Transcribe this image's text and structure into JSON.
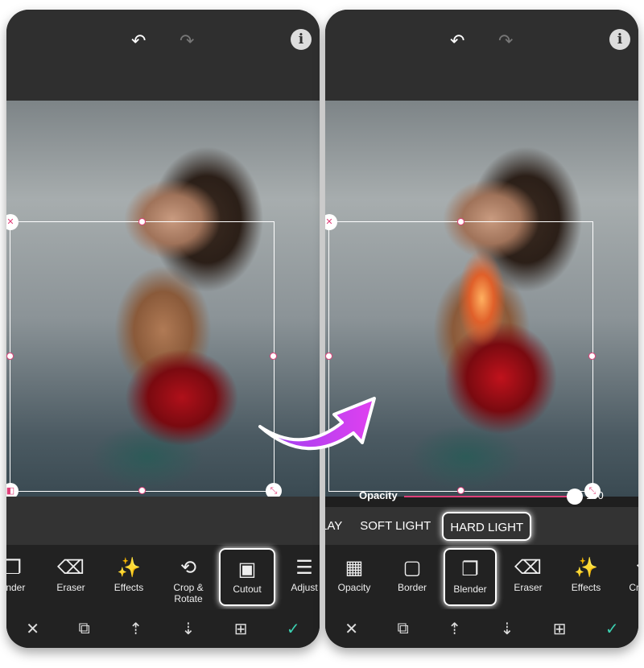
{
  "left": {
    "tools": [
      {
        "label": "ender",
        "icon": "blender-icon"
      },
      {
        "label": "Eraser",
        "icon": "eraser-icon"
      },
      {
        "label": "Effects",
        "icon": "magic-wand-icon"
      },
      {
        "label": "Crop & Rotate",
        "icon": "crop-rotate-icon"
      },
      {
        "label": "Cutout",
        "icon": "cutout-icon",
        "highlighted": true
      },
      {
        "label": "Adjust",
        "icon": "sliders-icon"
      }
    ]
  },
  "right": {
    "opacity_label": "Opacity",
    "opacity_value": "100",
    "opacity": 100,
    "blend_modes": [
      "LAY",
      "SOFT LIGHT",
      "HARD LIGHT"
    ],
    "selected_blend": "HARD LIGHT",
    "tools": [
      {
        "label": "Opacity",
        "icon": "checker-icon"
      },
      {
        "label": "Border",
        "icon": "border-icon"
      },
      {
        "label": "Blender",
        "icon": "blender-icon",
        "highlighted": true
      },
      {
        "label": "Eraser",
        "icon": "eraser-icon"
      },
      {
        "label": "Effects",
        "icon": "magic-wand-icon"
      },
      {
        "label": "Crop &",
        "icon": "crop-rotate-icon"
      }
    ]
  },
  "colors": {
    "accent": "#e0407a",
    "check": "#3bd0b0",
    "arrow": "#c040f0"
  }
}
